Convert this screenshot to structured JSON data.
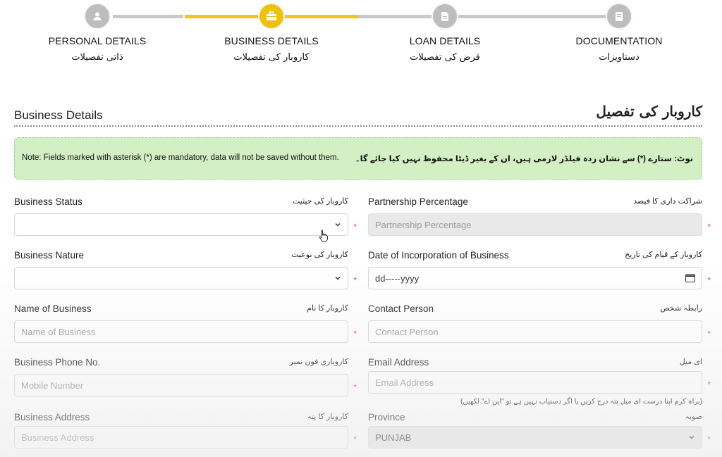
{
  "stepper": {
    "steps": [
      {
        "title": "PERSONAL DETAILS",
        "urdu": "ذاتی تفصیلات",
        "icon": "person-icon",
        "active": false
      },
      {
        "title": "BUSINESS DETAILS",
        "urdu": "کاروبار کی تفصیلات",
        "icon": "briefcase-icon",
        "active": true
      },
      {
        "title": "LOAN DETAILS",
        "urdu": "قرض کی تفصیلات",
        "icon": "document-icon",
        "active": false
      },
      {
        "title": "DOCUMENTATION",
        "urdu": "دستاویزات",
        "icon": "folder-icon",
        "active": false
      }
    ]
  },
  "section": {
    "title": "Business Details",
    "urdu_title": "کاروبار کی تفصیل"
  },
  "note": {
    "en": "Note: Fields marked with asterisk (*) are mandatory, data will not be saved without them.",
    "ur": "نوٹ: ستارے (*) سے نشان زدہ فیلڈز لازمی ہیں، ان کے بغیر ڈیٹا محفوظ نہیں کیا جائے گا۔"
  },
  "form": {
    "business_status": {
      "label": "Business Status",
      "urdu": "کاروبار کی حیثیت",
      "value": ""
    },
    "partnership_percentage": {
      "label": "Partnership Percentage",
      "urdu": "شراکت داری کا فیصد",
      "placeholder": "Partnership Percentage"
    },
    "business_nature": {
      "label": "Business Nature",
      "urdu": "کاروبار کی نوعیت",
      "value": ""
    },
    "date_incorporation": {
      "label": "Date of Incorporation of Business",
      "urdu": "کاروبار کے قیام کی تاریخ",
      "value": "dd-----yyyy"
    },
    "business_name": {
      "label": "Name of Business",
      "urdu": "کاروبار کا نام",
      "placeholder": "Name of Business"
    },
    "contact_person": {
      "label": "Contact Person",
      "urdu": "رابطہ شخص",
      "placeholder": "Contact Person"
    },
    "business_phone": {
      "label": "Business Phone No.",
      "urdu": "کاروباری فون نمبر",
      "placeholder": "Mobile Number"
    },
    "email": {
      "label": "Email Address",
      "urdu": "ای میل",
      "placeholder": "Email Address",
      "hint": "(براہ کرم اپنا درست ای میل پتہ درج کریں یا اگر دستیاب نہیں ہے تو \"این اے\" لکھیں)"
    },
    "business_address": {
      "label": "Business Address",
      "urdu": "کاروبار کا پتہ",
      "placeholder": "Business Address"
    },
    "province": {
      "label": "Province",
      "urdu": "صوبہ",
      "value": "PUNJAB"
    }
  },
  "colors": {
    "accent": "#efc10f",
    "required": "#e0475b",
    "note_bg": "#d3f0c4"
  }
}
